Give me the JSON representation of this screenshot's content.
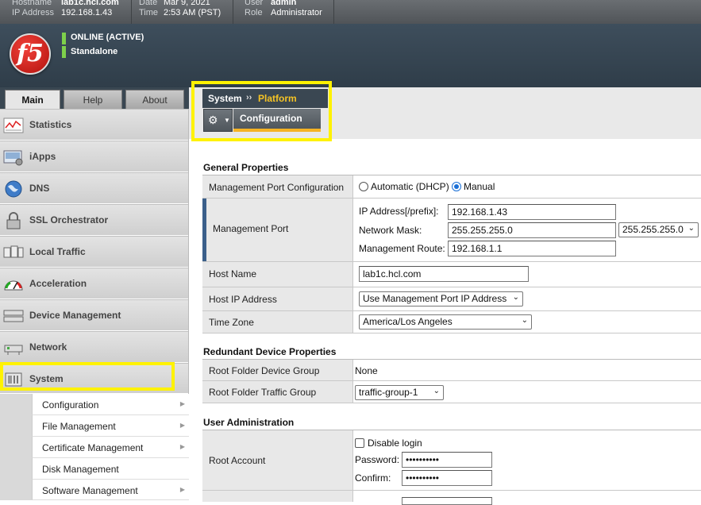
{
  "topbar": {
    "hostname_label": "Hostname",
    "hostname_value": "lab1c.hcl.com",
    "ip_label": "IP Address",
    "ip_value": "192.168.1.43",
    "date_label": "Date",
    "date_value": "Mar 9, 2021",
    "time_label": "Time",
    "time_value": "2:53 AM (PST)",
    "user_label": "User",
    "user_value": "admin",
    "role_label": "Role",
    "role_value": "Administrator"
  },
  "banner": {
    "logo_text": "f5",
    "status1": "ONLINE (ACTIVE)",
    "status2": "Standalone"
  },
  "nav_tabs": [
    {
      "label": "Main",
      "active": true
    },
    {
      "label": "Help",
      "active": false
    },
    {
      "label": "About",
      "active": false
    }
  ],
  "nav_items": [
    {
      "label": "Statistics",
      "icon": "statistics-icon"
    },
    {
      "label": "iApps",
      "icon": "iapps-icon"
    },
    {
      "label": "DNS",
      "icon": "dns-globe-icon"
    },
    {
      "label": "SSL Orchestrator",
      "icon": "ssl-lock-icon"
    },
    {
      "label": "Local Traffic",
      "icon": "local-traffic-icon"
    },
    {
      "label": "Acceleration",
      "icon": "acceleration-gauge-icon"
    },
    {
      "label": "Device Management",
      "icon": "device-management-icon"
    },
    {
      "label": "Network",
      "icon": "network-icon"
    },
    {
      "label": "System",
      "icon": "system-icon"
    }
  ],
  "system_subnav": [
    {
      "label": "Configuration"
    },
    {
      "label": "File Management"
    },
    {
      "label": "Certificate Management"
    },
    {
      "label": "Disk Management"
    },
    {
      "label": "Software Management"
    }
  ],
  "breadcrumb": {
    "section": "System",
    "separator": "››",
    "page": "Platform"
  },
  "tabs": {
    "configuration": "Configuration"
  },
  "general": {
    "title": "General Properties",
    "mgmt_port_config_label": "Management Port Configuration",
    "opt_dhcp": "Automatic (DHCP)",
    "opt_manual": "Manual",
    "mgmt_port_label": "Management Port",
    "ip_prefix_label": "IP Address[/prefix]:",
    "ip_prefix_value": "192.168.1.43",
    "netmask_label": "Network Mask:",
    "netmask_value": "255.255.255.0",
    "netmask_select": "255.255.255.0",
    "route_label": "Management Route:",
    "route_value": "192.168.1.1",
    "hostname_label": "Host Name",
    "hostname_value": "lab1c.hcl.com",
    "host_ip_label": "Host IP Address",
    "host_ip_select": "Use Management Port IP Address",
    "timezone_label": "Time Zone",
    "timezone_select": "America/Los Angeles"
  },
  "redundant": {
    "title": "Redundant Device Properties",
    "device_group_label": "Root Folder Device Group",
    "device_group_value": "None",
    "traffic_group_label": "Root Folder Traffic Group",
    "traffic_group_select": "traffic-group-1"
  },
  "useradmin": {
    "title": "User Administration",
    "root_label": "Root Account",
    "disable_login": "Disable login",
    "password_label": "Password:",
    "password_value": "••••••••••",
    "confirm_label": "Confirm:",
    "confirm_value": "••••••••••"
  },
  "colors": {
    "highlight": "#fff200",
    "accent_orange": "#f5b324",
    "online_green": "#7ed04b",
    "nav_dark": "#3a4752"
  }
}
